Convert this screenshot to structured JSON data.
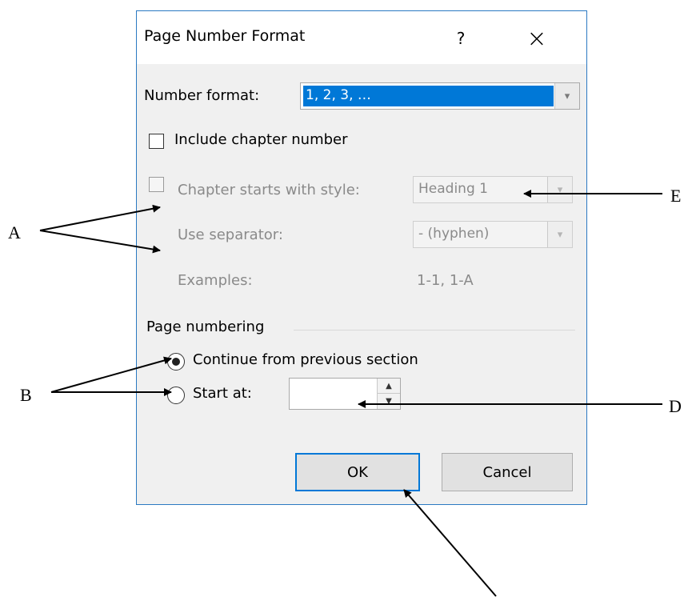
{
  "dialog": {
    "title": "Page Number Format",
    "help_label": "?",
    "close_label": "×"
  },
  "number_format": {
    "label": "Number format:",
    "value": "1, 2, 3, …"
  },
  "include_chapter": {
    "label": "Include chapter number",
    "checked": false
  },
  "chapter_style": {
    "label": "Chapter starts with style:",
    "value": "Heading 1"
  },
  "separator": {
    "label": "Use separator:",
    "value": "-  (hyphen)"
  },
  "examples": {
    "label": "Examples:",
    "value": "1-1, 1-A"
  },
  "page_numbering": {
    "group_label": "Page numbering",
    "continue_label": "Continue from previous section",
    "start_at_label": "Start at:",
    "start_at_value": "",
    "selected": "continue"
  },
  "buttons": {
    "ok": "OK",
    "cancel": "Cancel"
  },
  "callouts": {
    "a": "A",
    "b": "B",
    "d": "D",
    "e": "E"
  },
  "colors": {
    "selection": "#0078d7",
    "dialog_border": "#2b79c2",
    "dialog_body": "#f0f0f0"
  }
}
